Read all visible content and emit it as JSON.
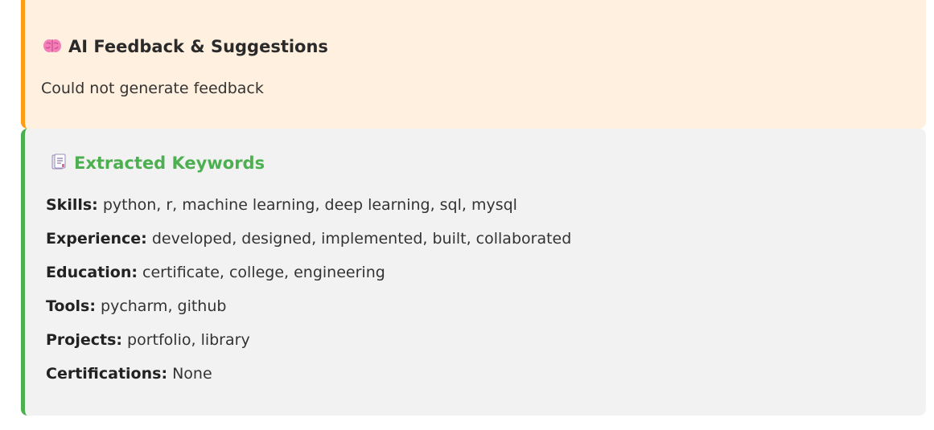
{
  "feedback": {
    "title": "AI Feedback & Suggestions",
    "icon": "brain-icon",
    "message": "Could not generate feedback",
    "accent_color": "#ff9b15"
  },
  "keywords": {
    "title": "Extracted Keywords",
    "icon": "document-icon",
    "accent_color": "#4caf50",
    "items": [
      {
        "label": "Skills:",
        "value": "python, r, machine learning, deep learning, sql, mysql"
      },
      {
        "label": "Experience:",
        "value": "developed, designed, implemented, built, collaborated"
      },
      {
        "label": "Education:",
        "value": "certificate, college, engineering"
      },
      {
        "label": "Tools:",
        "value": "pycharm, github"
      },
      {
        "label": "Projects:",
        "value": "portfolio, library"
      },
      {
        "label": "Certifications:",
        "value": "None"
      }
    ]
  }
}
